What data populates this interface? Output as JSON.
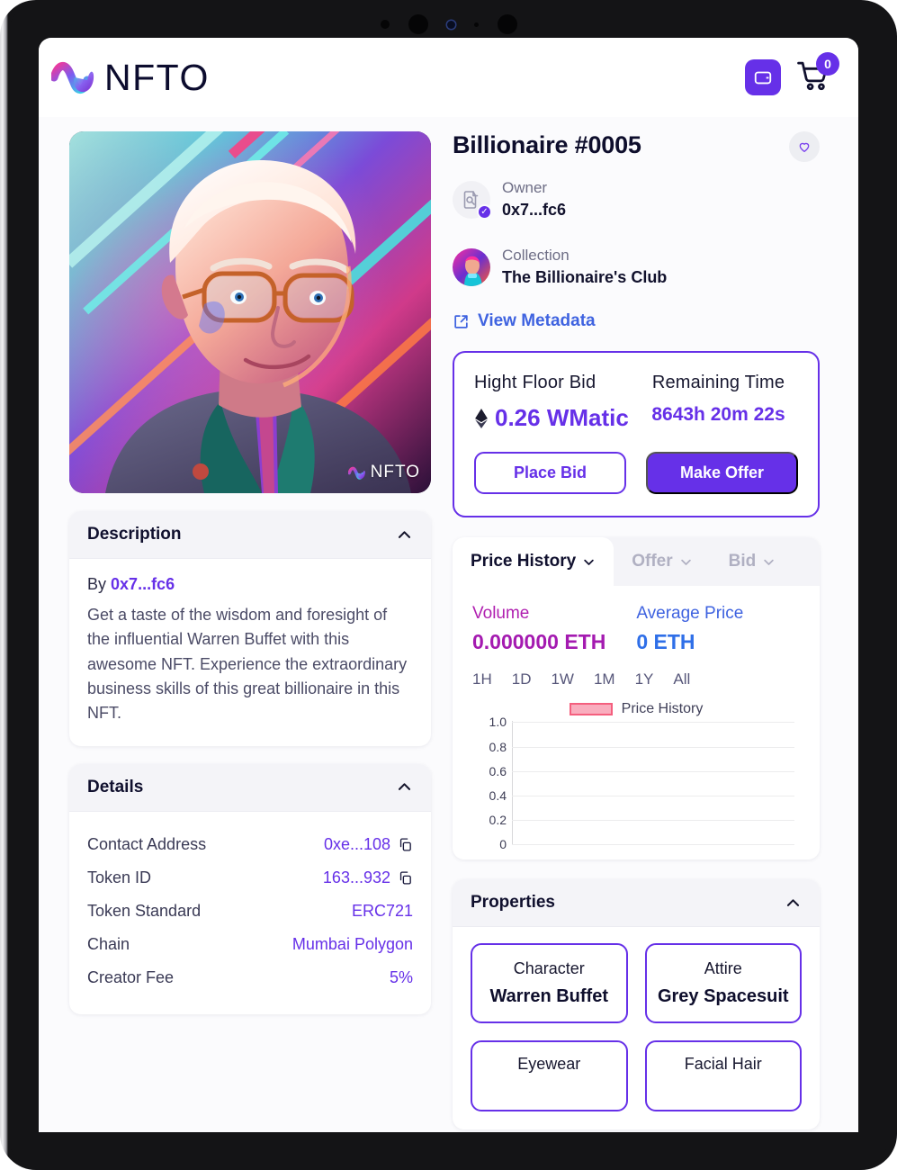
{
  "header": {
    "brand": "NFTO",
    "wallet_icon": "wallet-icon",
    "cart_icon": "cart-icon",
    "cart_count": "0"
  },
  "artwork": {
    "watermark": "NFTO",
    "alt": "Neon stylized portrait of Warren Buffet"
  },
  "detail": {
    "title": "Billionaire #0005",
    "favorite_icon": "heart-icon",
    "owner_label": "Owner",
    "owner_value": "0x7...fc6",
    "owner_avatar": "no-image-found-placeholder",
    "collection_label": "Collection",
    "collection_value": "The Billionaire's Club",
    "metadata_link": "View Metadata"
  },
  "bid": {
    "floor_label": "Hight  Floor  Bid",
    "floor_price": "0.26 WMatic",
    "currency_icon": "ethereum-diamond-icon",
    "time_label": "Remaining Time",
    "time_value": "8643h 20m 22s",
    "place_bid": "Place Bid",
    "make_offer": "Make Offer"
  },
  "description": {
    "title": "Description",
    "by_prefix": "By",
    "by_address": "0x7...fc6",
    "text": "Get a taste of the wisdom and foresight of the influential Warren Buffet with this awesome NFT. Experience the extraordinary business skills of this great billionaire in this NFT."
  },
  "details": {
    "title": "Details",
    "rows": [
      {
        "label": "Contact Address",
        "value": "0xe...108",
        "copy": true
      },
      {
        "label": "Token ID",
        "value": "163...932",
        "copy": true
      },
      {
        "label": "Token Standard",
        "value": "ERC721",
        "copy": false
      },
      {
        "label": "Chain",
        "value": "Mumbai Polygon",
        "copy": false
      },
      {
        "label": "Creator Fee",
        "value": "5%",
        "copy": false
      }
    ]
  },
  "history": {
    "tabs": [
      {
        "label": "Price History",
        "active": true
      },
      {
        "label": "Offer",
        "active": false
      },
      {
        "label": "Bid",
        "active": false
      }
    ],
    "volume_label": "Volume",
    "volume_value": "0.000000 ETH",
    "average_label": "Average Price",
    "average_value": "0 ETH",
    "ranges": [
      "1H",
      "1D",
      "1W",
      "1M",
      "1Y",
      "All"
    ]
  },
  "chart_data": {
    "type": "line",
    "title": "",
    "legend": [
      "Price History"
    ],
    "legend_position": "top-center",
    "legend_color": "#f9adbe",
    "legend_border_color": "#f45f7e",
    "xlabel": "",
    "ylabel": "",
    "ylim": [
      0,
      1.0
    ],
    "yticks": [
      "1.0",
      "0.8",
      "0.6",
      "0.4",
      "0.2",
      "0"
    ],
    "grid": true,
    "x": [],
    "series": [
      {
        "name": "Price History",
        "values": []
      }
    ]
  },
  "properties": {
    "title": "Properties",
    "items": [
      {
        "type": "Character",
        "value": "Warren Buffet",
        "clipped": false
      },
      {
        "type": "Attire",
        "value": "Grey Spacesuit",
        "clipped": false
      },
      {
        "type": "Eyewear",
        "value": "",
        "clipped": true
      },
      {
        "type": "Facial Hair",
        "value": "",
        "clipped": true
      }
    ]
  },
  "colors": {
    "primary": "#6630e8",
    "link": "#3f63e0",
    "volume": "#a41ab0",
    "average": "#2f6fe8",
    "dark": "#0e0e2c"
  }
}
